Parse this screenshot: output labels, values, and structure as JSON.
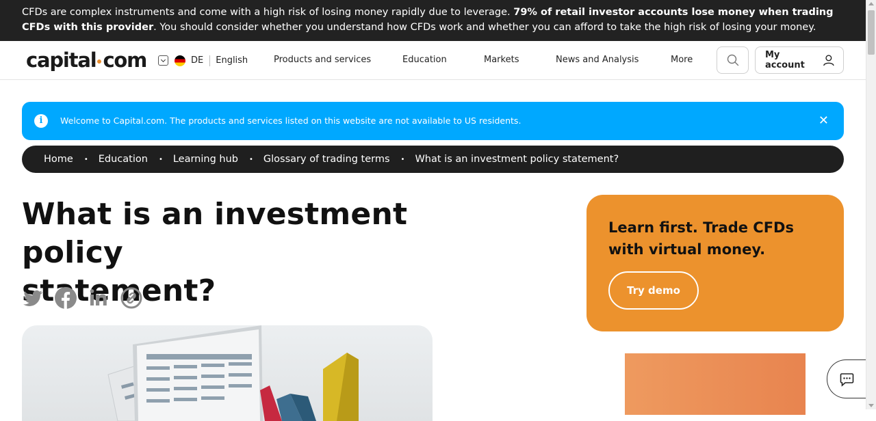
{
  "risk_banner": {
    "text_start": "CFDs are complex instruments and come with a high risk of losing money rapidly due to leverage. ",
    "text_bold": "79% of retail investor accounts lose money when trading CFDs with this provider",
    "text_end": ". You should consider whether you understand how CFDs work and whether you can afford to take the high risk of losing your money."
  },
  "header": {
    "logo_left": "capital",
    "logo_right": "com",
    "country": "DE",
    "language": "English",
    "nav": [
      "Products and services",
      "Education",
      "Markets",
      "News and Analysis",
      "More"
    ],
    "account_label": "My account"
  },
  "welcome": {
    "info_glyph": "i",
    "text": "Welcome to Capital.com. The products and services listed on this website are not available to US residents.",
    "close_glyph": "✕"
  },
  "breadcrumb": [
    "Home",
    "Education",
    "Learning hub",
    "Glossary of trading terms",
    "What is an investment policy statement?"
  ],
  "breadcrumb_sep": "•",
  "article": {
    "title_line1": "What is an investment policy",
    "title_line2": "statement?"
  },
  "share_icons": [
    "twitter-icon",
    "facebook-icon",
    "linkedin-icon",
    "copy-link-icon"
  ],
  "promo": {
    "text": "Learn first. Trade CFDs with virtual money.",
    "button": "Try demo"
  },
  "colors": {
    "banner": "#222222",
    "welcome": "#00a8ff",
    "breadcrumb": "#1f1f1f",
    "promo": "#ec922d",
    "logo_dot": "#e98c2b"
  }
}
